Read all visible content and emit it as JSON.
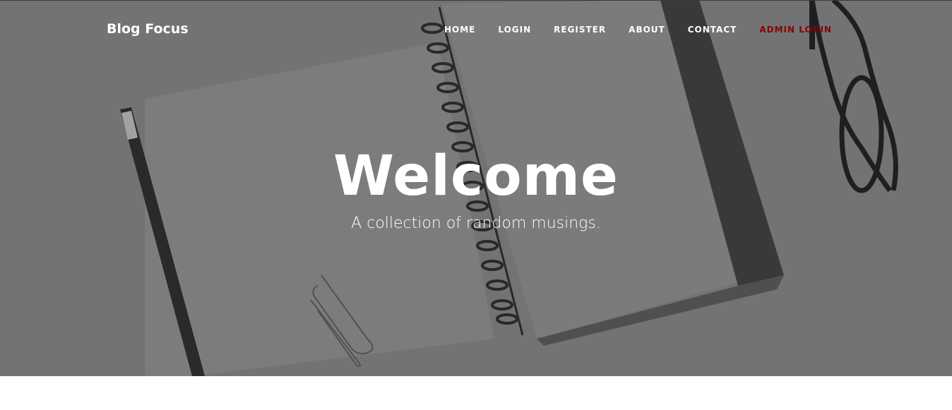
{
  "nav": {
    "brand": "Blog Focus",
    "items": [
      {
        "label": "HOME"
      },
      {
        "label": "LOGIN"
      },
      {
        "label": "REGISTER"
      },
      {
        "label": "ABOUT"
      },
      {
        "label": "CONTACT"
      },
      {
        "label": "ADMIN LOGIN"
      }
    ]
  },
  "hero": {
    "heading": "Welcome",
    "subheading": "A collection of random musings."
  },
  "colors": {
    "nav_text": "#ffffff",
    "admin_link": "#8a0000",
    "hero_overlay": "#7b7b7d"
  }
}
